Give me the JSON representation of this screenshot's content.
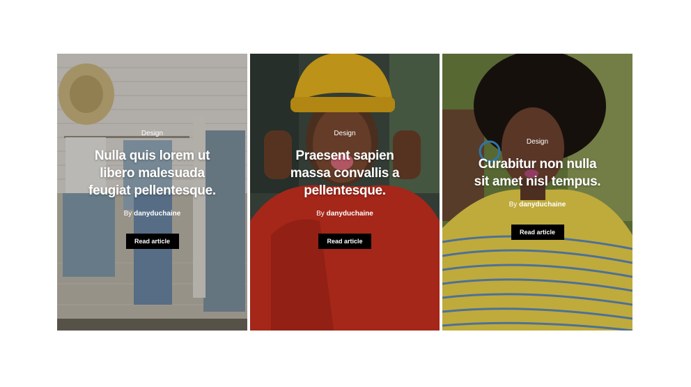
{
  "cards": [
    {
      "category": "Design",
      "title_lines": [
        "Nulla quis lorem ut",
        "libero malesuada",
        "feugiat pellentesque."
      ],
      "by_prefix": "By",
      "author": "danyduchaine",
      "button_label": "Read article"
    },
    {
      "category": "Design",
      "title_lines": [
        "Praesent sapien",
        "massa convallis a",
        "pellentesque."
      ],
      "by_prefix": "By",
      "author": "danyduchaine",
      "button_label": "Read article"
    },
    {
      "category": "Design",
      "title_lines": [
        "Curabitur non nulla",
        "sit amet nisl tempus."
      ],
      "by_prefix": "By",
      "author": "danyduchaine",
      "button_label": "Read article"
    }
  ],
  "colors": {
    "button_bg": "#000000",
    "text": "#ffffff",
    "page_bg": "#ffffff"
  }
}
